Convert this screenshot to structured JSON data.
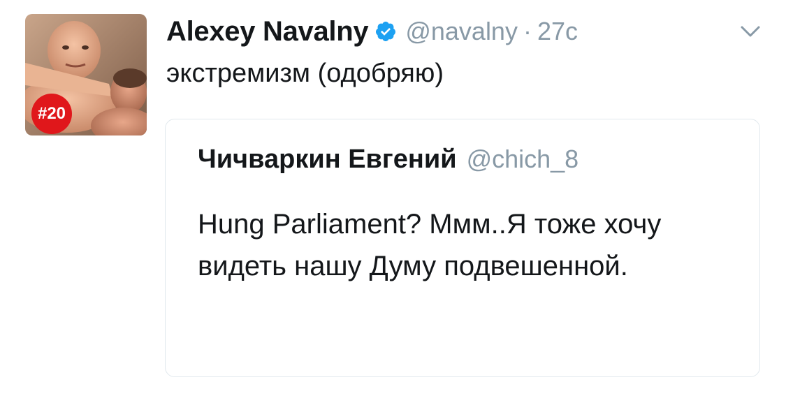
{
  "tweet": {
    "author": {
      "name": "Alexey Navalny",
      "handle": "@navalny",
      "verified": true,
      "avatar_badge": "#20"
    },
    "separator": "·",
    "time": "27с",
    "text": "экстремизм (одобряю)",
    "menu_icon": "chevron-down-icon"
  },
  "quoted_tweet": {
    "author": {
      "name": "Чичваркин Евгений",
      "handle": "@chich_8"
    },
    "text": "Hung Parliament? Ммм..Я тоже хочу видеть нашу Думу подвешенной."
  },
  "colors": {
    "text": "#14171a",
    "secondary": "#8899a6",
    "verified_blue": "#1da1f2",
    "border": "#e1e8ed",
    "badge_red": "#e0171b"
  }
}
